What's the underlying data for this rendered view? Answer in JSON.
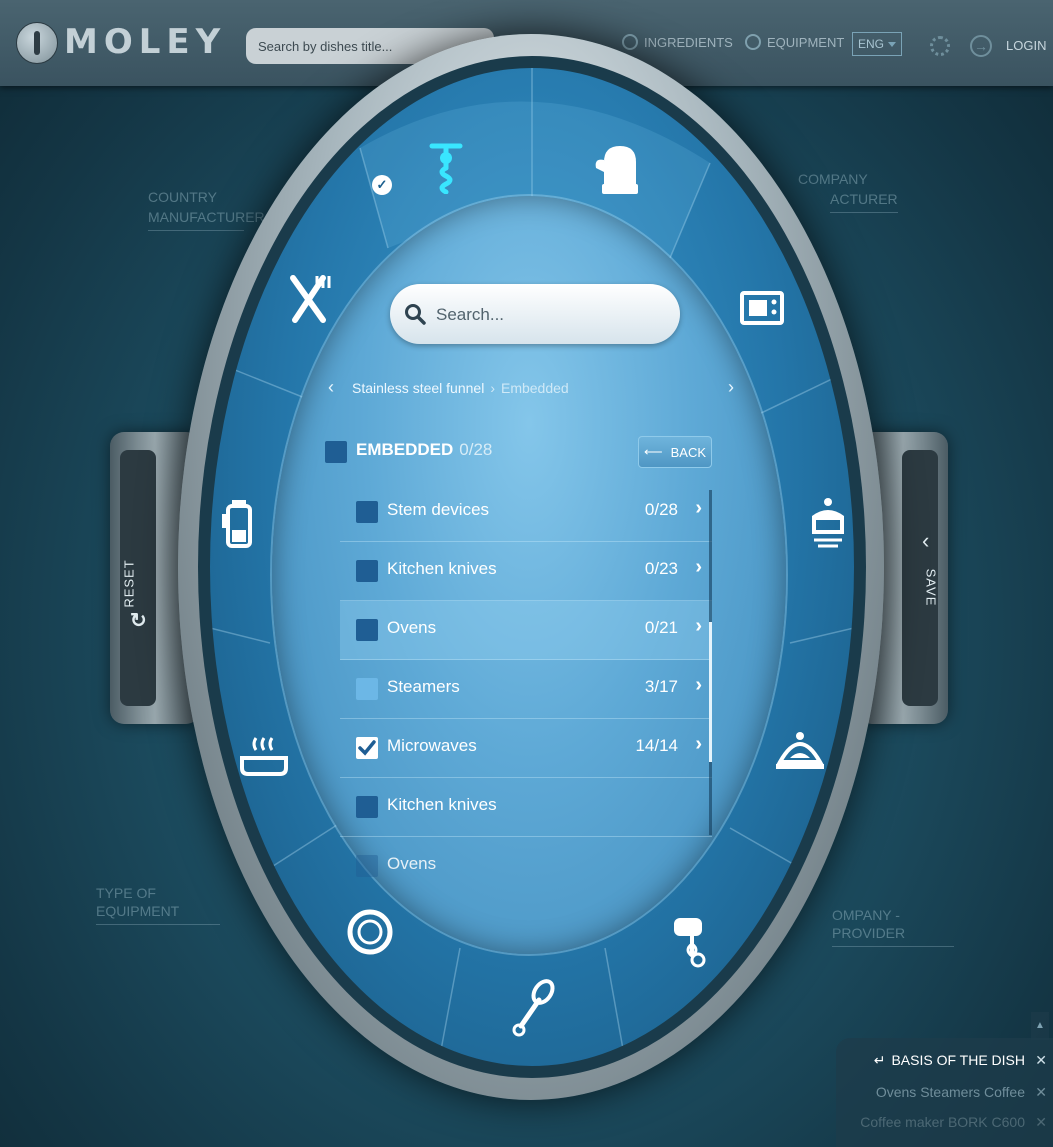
{
  "header": {
    "logo_text": "MOLEY",
    "search_placeholder": "Search by dishes title...",
    "nav_ingredients": "INGREDIENTS",
    "nav_equipment": "EQUIPMENT",
    "language": "ENG",
    "login": "LOGIN"
  },
  "background_labels": {
    "country_manufacturer_1": "COUNTRY",
    "country_manufacturer_2": "MANUFACTURER",
    "company_manufacturer_1": "COMPANY",
    "company_manufacturer_2": "ACTURER",
    "type_of_equipment": "TYPE OF EQUIPMENT",
    "company_provider": "OMPANY - PROVIDER"
  },
  "side_buttons": {
    "reset": "RESET",
    "save": "SAVE"
  },
  "filter": {
    "search_placeholder": "Search...",
    "breadcrumb": [
      "Stainless steel funnel",
      "Embedded"
    ],
    "heading": "EMBEDDED",
    "heading_count": "0/28",
    "back_label": "BACK",
    "items": [
      {
        "label": "Stem devices",
        "count": "0/28",
        "state": "unchecked",
        "highlighted": false
      },
      {
        "label": "Kitchen knives",
        "count": "0/23",
        "state": "unchecked",
        "highlighted": false
      },
      {
        "label": "Ovens",
        "count": "0/21",
        "state": "unchecked",
        "highlighted": true
      },
      {
        "label": "Steamers",
        "count": "3/17",
        "state": "partial",
        "highlighted": false
      },
      {
        "label": "Microwaves",
        "count": "14/14",
        "state": "checked",
        "highlighted": false
      },
      {
        "label": "Kitchen knives",
        "count": "",
        "state": "unchecked",
        "highlighted": false
      },
      {
        "label": "Ovens",
        "count": "",
        "state": "unchecked",
        "highlighted": false
      }
    ]
  },
  "ring_icons": [
    "corkscrew-icon",
    "oven-mitt-icon",
    "microwave-icon",
    "steamer-pot-icon",
    "cloche-icon",
    "hand-mixer-icon",
    "whisk-icon",
    "plate-icon",
    "roasting-pan-icon",
    "kettle-icon",
    "fork-knife-icon"
  ],
  "selected_tags": {
    "title": "BASIS OF THE DISH",
    "item1": "Ovens Steamers Coffee",
    "item2": "Coffee maker BORK C600"
  },
  "colors": {
    "accent": "#3b9ad0",
    "active_icon": "#39e6ff"
  }
}
